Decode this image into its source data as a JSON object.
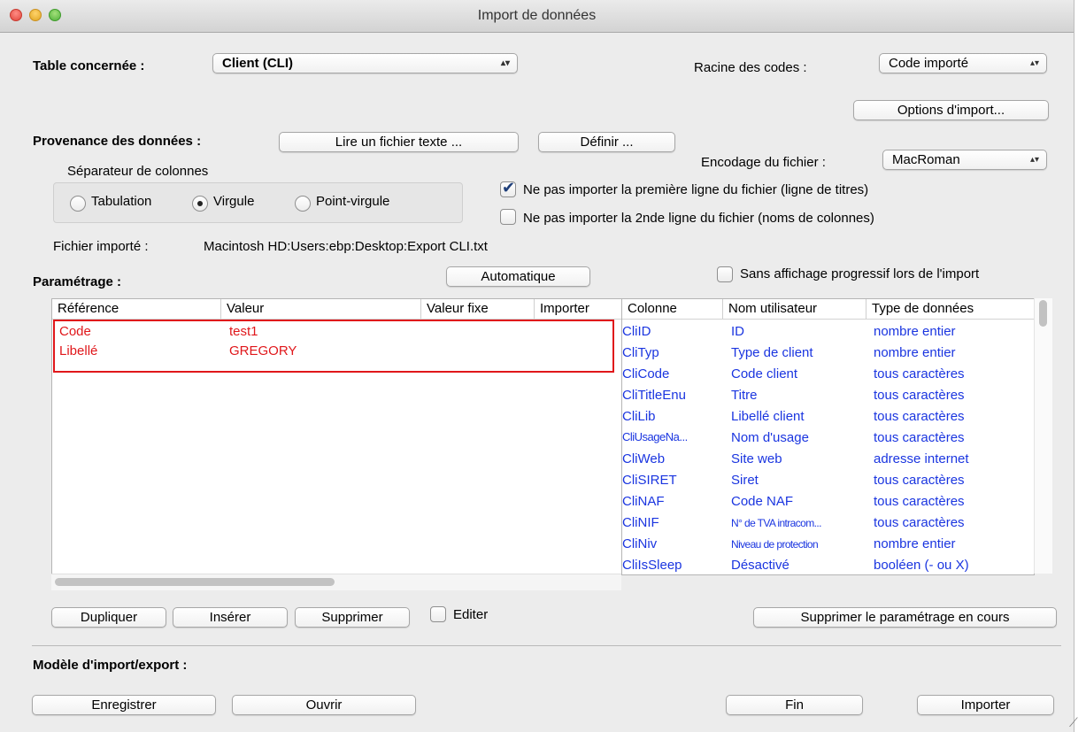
{
  "window": {
    "title": "Import de données"
  },
  "table_section": {
    "label": "Table concernée :",
    "value": "Client  (CLI)"
  },
  "codes": {
    "label": "Racine des codes :",
    "value": "Code importé"
  },
  "options_button": "Options d'import...",
  "source": {
    "label": "Provenance des données :",
    "read_button": "Lire un fichier texte ...",
    "define_button": "Définir ...",
    "separator_label": "Séparateur de colonnes",
    "separators": [
      "Tabulation",
      "Virgule",
      "Point-virgule"
    ],
    "selected_separator": "Virgule"
  },
  "encoding": {
    "label": "Encodage du fichier :",
    "value": "MacRoman"
  },
  "checkboxes": {
    "skip_first": {
      "label": "Ne pas importer la première ligne du fichier (ligne de titres)",
      "checked": true
    },
    "skip_second": {
      "label": "Ne pas importer la 2nde ligne du fichier (noms de colonnes)",
      "checked": false
    },
    "no_progress": {
      "label": "Sans affichage progressif lors de l'import",
      "checked": false
    },
    "edit": {
      "label": "Editer",
      "checked": false
    }
  },
  "imported_file": {
    "label": "Fichier importé :",
    "path": "Macintosh HD:Users:ebp:Desktop:Export CLI.txt"
  },
  "settings": {
    "label": "Paramétrage :",
    "auto_button": "Automatique",
    "mapping_headers": [
      "Référence",
      "Valeur",
      "Valeur fixe",
      "Importer"
    ],
    "mapping_rows": [
      {
        "ref": "Code",
        "value": "test1"
      },
      {
        "ref": "Libellé",
        "value": "GREGORY"
      }
    ],
    "columns_headers": [
      "Colonne",
      "Nom utilisateur",
      "Type de données"
    ],
    "columns_rows": [
      {
        "col": "CliID",
        "name": "ID",
        "type": "nombre entier"
      },
      {
        "col": "CliTyp",
        "name": "Type de client",
        "type": "nombre entier"
      },
      {
        "col": "CliCode",
        "name": "Code client",
        "type": "tous caractères"
      },
      {
        "col": "CliTitleEnu",
        "name": "Titre",
        "type": "tous caractères"
      },
      {
        "col": "CliLib",
        "name": "Libellé client",
        "type": "tous caractères"
      },
      {
        "col": "CliUsageNa...",
        "name": "Nom d'usage",
        "type": "tous caractères"
      },
      {
        "col": "CliWeb",
        "name": "Site web",
        "type": "adresse internet"
      },
      {
        "col": "CliSIRET",
        "name": "Siret",
        "type": "tous caractères"
      },
      {
        "col": "CliNAF",
        "name": "Code NAF",
        "type": "tous caractères"
      },
      {
        "col": "CliNIF",
        "name": "N° de TVA intracom...",
        "type": "tous caractères"
      },
      {
        "col": "CliNiv",
        "name": "Niveau de protection",
        "type": "nombre entier"
      },
      {
        "col": "CliIsSleep",
        "name": "Désactivé",
        "type": "booléen (- ou X)"
      }
    ]
  },
  "bottom_buttons": {
    "duplicate": "Dupliquer",
    "insert": "Insérer",
    "delete": "Supprimer",
    "clear_settings": "Supprimer le paramétrage en cours"
  },
  "model": {
    "label": "Modèle d'import/export :",
    "save": "Enregistrer",
    "open": "Ouvrir",
    "finish": "Fin",
    "import": "Importer"
  },
  "colors": {
    "mapping_text": "#e0171b",
    "columns_text": "#1a35e0",
    "highlight_border": "#e0171b"
  }
}
